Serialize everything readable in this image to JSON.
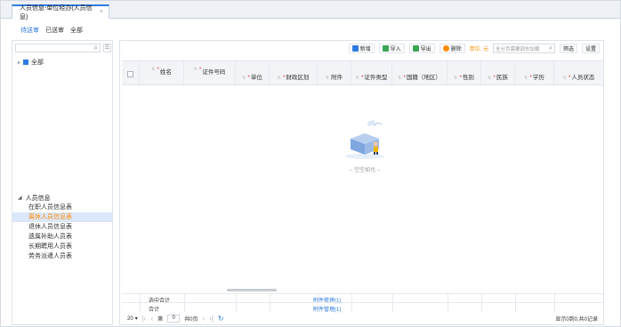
{
  "tab": {
    "label": "人员信息-单位经办(人员信息)",
    "close": "×"
  },
  "filters": [
    {
      "label": "待送审",
      "active": true
    },
    {
      "label": "已送审",
      "active": false
    },
    {
      "label": "全部",
      "active": false
    }
  ],
  "left": {
    "root_label": "全部",
    "group_title": "人员信息",
    "items": [
      {
        "label": "在职人员信息表",
        "selected": false
      },
      {
        "label": "离休人员信息表",
        "selected": true
      },
      {
        "label": "退休人员信息表",
        "selected": false
      },
      {
        "label": "遗属补助人员表",
        "selected": false
      },
      {
        "label": "长期聘用人员表",
        "selected": false
      },
      {
        "label": "劳务派遣人员表",
        "selected": false
      }
    ]
  },
  "toolbar": {
    "add": "新增",
    "import": "导入",
    "export": "导出",
    "delete": "删除",
    "unit": "单位: 元",
    "search_placeholder": "全分页需要回车加载",
    "filter": "筛选",
    "settings": "设置"
  },
  "columns": [
    {
      "label": "姓名",
      "required": true
    },
    {
      "label": "证件号码",
      "required": true
    },
    {
      "label": "单位",
      "required": true
    },
    {
      "label": "财政区划",
      "required": true
    },
    {
      "label": "附件",
      "required": false
    },
    {
      "label": "证件类型",
      "required": true
    },
    {
      "label": "国籍（地区）",
      "required": true
    },
    {
      "label": "性别",
      "required": true
    },
    {
      "label": "民族",
      "required": true
    },
    {
      "label": "学历",
      "required": true
    },
    {
      "label": "人员状态",
      "required": true
    }
  ],
  "empty_text": "-- 空空如也 --",
  "summary": {
    "selected_total": "选中合计",
    "total": "合计",
    "attachment_link": "附件管理(1)"
  },
  "pager": {
    "page_size": "20",
    "page_prefix": "第",
    "page_value": "0",
    "page_suffix": "共0页",
    "info": "显示0到0,共0记录"
  },
  "colors": {
    "accent": "#2d7be0",
    "selected_item_text": "#ff8c00",
    "required_mark": "#e23b3b"
  }
}
